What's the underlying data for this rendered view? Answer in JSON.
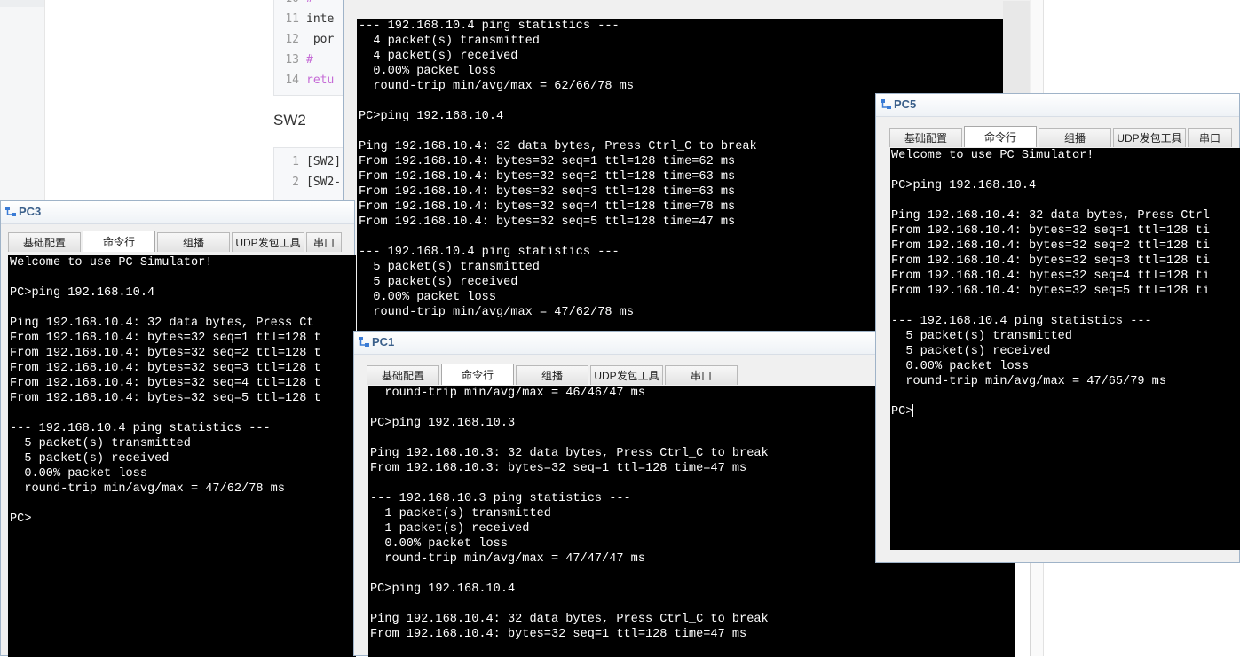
{
  "doc": {
    "code_block_1": [
      {
        "ln": "10",
        "text": "#",
        "kind": "hash"
      },
      {
        "ln": "11",
        "text": "inte",
        "kind": "code"
      },
      {
        "ln": "12",
        "text": " por",
        "kind": "code"
      },
      {
        "ln": "13",
        "text": "#",
        "kind": "hash"
      },
      {
        "ln": "14",
        "text": "retu",
        "kind": "ret"
      }
    ],
    "heading": "SW2",
    "code_block_2": [
      {
        "ln": "1",
        "text": "[SW2]",
        "kind": "code"
      },
      {
        "ln": "2",
        "text": "[SW2-",
        "kind": "code"
      }
    ]
  },
  "tabs": {
    "basic": "基础配置",
    "cmd": "命令行",
    "multicast": "组播",
    "udp": "UDP发包工具",
    "serial": "串口"
  },
  "windows": {
    "pc_top": {
      "title": "",
      "lines": [
        "--- 192.168.10.4 ping statistics ---",
        "  4 packet(s) transmitted",
        "  4 packet(s) received",
        "  0.00% packet loss",
        "  round-trip min/avg/max = 62/66/78 ms",
        "",
        "PC>ping 192.168.10.4",
        "",
        "Ping 192.168.10.4: 32 data bytes, Press Ctrl_C to break",
        "From 192.168.10.4: bytes=32 seq=1 ttl=128 time=62 ms",
        "From 192.168.10.4: bytes=32 seq=2 ttl=128 time=63 ms",
        "From 192.168.10.4: bytes=32 seq=3 ttl=128 time=63 ms",
        "From 192.168.10.4: bytes=32 seq=4 ttl=128 time=78 ms",
        "From 192.168.10.4: bytes=32 seq=5 ttl=128 time=47 ms",
        "",
        "--- 192.168.10.4 ping statistics ---",
        "  5 packet(s) transmitted",
        "  5 packet(s) received",
        "  0.00% packet loss",
        "  round-trip min/avg/max = 47/62/78 ms"
      ]
    },
    "pc3": {
      "title": "PC3",
      "lines": [
        "Welcome to use PC Simulator!",
        "",
        "PC>ping 192.168.10.4",
        "",
        "Ping 192.168.10.4: 32 data bytes, Press Ct",
        "From 192.168.10.4: bytes=32 seq=1 ttl=128 t",
        "From 192.168.10.4: bytes=32 seq=2 ttl=128 t",
        "From 192.168.10.4: bytes=32 seq=3 ttl=128 t",
        "From 192.168.10.4: bytes=32 seq=4 ttl=128 t",
        "From 192.168.10.4: bytes=32 seq=5 ttl=128 t",
        "",
        "--- 192.168.10.4 ping statistics ---",
        "  5 packet(s) transmitted",
        "  5 packet(s) received",
        "  0.00% packet loss",
        "  round-trip min/avg/max = 47/62/78 ms",
        "",
        "PC>"
      ]
    },
    "pc1": {
      "title": "PC1",
      "lines": [
        "  round-trip min/avg/max = 46/46/47 ms",
        "",
        "PC>ping 192.168.10.3",
        "",
        "Ping 192.168.10.3: 32 data bytes, Press Ctrl_C to break",
        "From 192.168.10.3: bytes=32 seq=1 ttl=128 time=47 ms",
        "",
        "--- 192.168.10.3 ping statistics ---",
        "  1 packet(s) transmitted",
        "  1 packet(s) received",
        "  0.00% packet loss",
        "  round-trip min/avg/max = 47/47/47 ms",
        "",
        "PC>ping 192.168.10.4",
        "",
        "Ping 192.168.10.4: 32 data bytes, Press Ctrl_C to break",
        "From 192.168.10.4: bytes=32 seq=1 ttl=128 time=47 ms"
      ]
    },
    "pc5": {
      "title": "PC5",
      "lines": [
        "Welcome to use PC Simulator!",
        "",
        "PC>ping 192.168.10.4",
        "",
        "Ping 192.168.10.4: 32 data bytes, Press Ctrl",
        "From 192.168.10.4: bytes=32 seq=1 ttl=128 ti",
        "From 192.168.10.4: bytes=32 seq=2 ttl=128 ti",
        "From 192.168.10.4: bytes=32 seq=3 ttl=128 ti",
        "From 192.168.10.4: bytes=32 seq=4 ttl=128 ti",
        "From 192.168.10.4: bytes=32 seq=5 ttl=128 ti",
        "",
        "--- 192.168.10.4 ping statistics ---",
        "  5 packet(s) transmitted",
        "  5 packet(s) received",
        "  0.00% packet loss",
        "  round-trip min/avg/max = 47/65/79 ms",
        "",
        "PC>"
      ]
    }
  },
  "colors": {
    "terminal_bg": "#000000",
    "terminal_fg": "#ffffff",
    "title_text": "#3a5f8a"
  },
  "icons": {
    "window_icon": "network-pc-icon"
  }
}
